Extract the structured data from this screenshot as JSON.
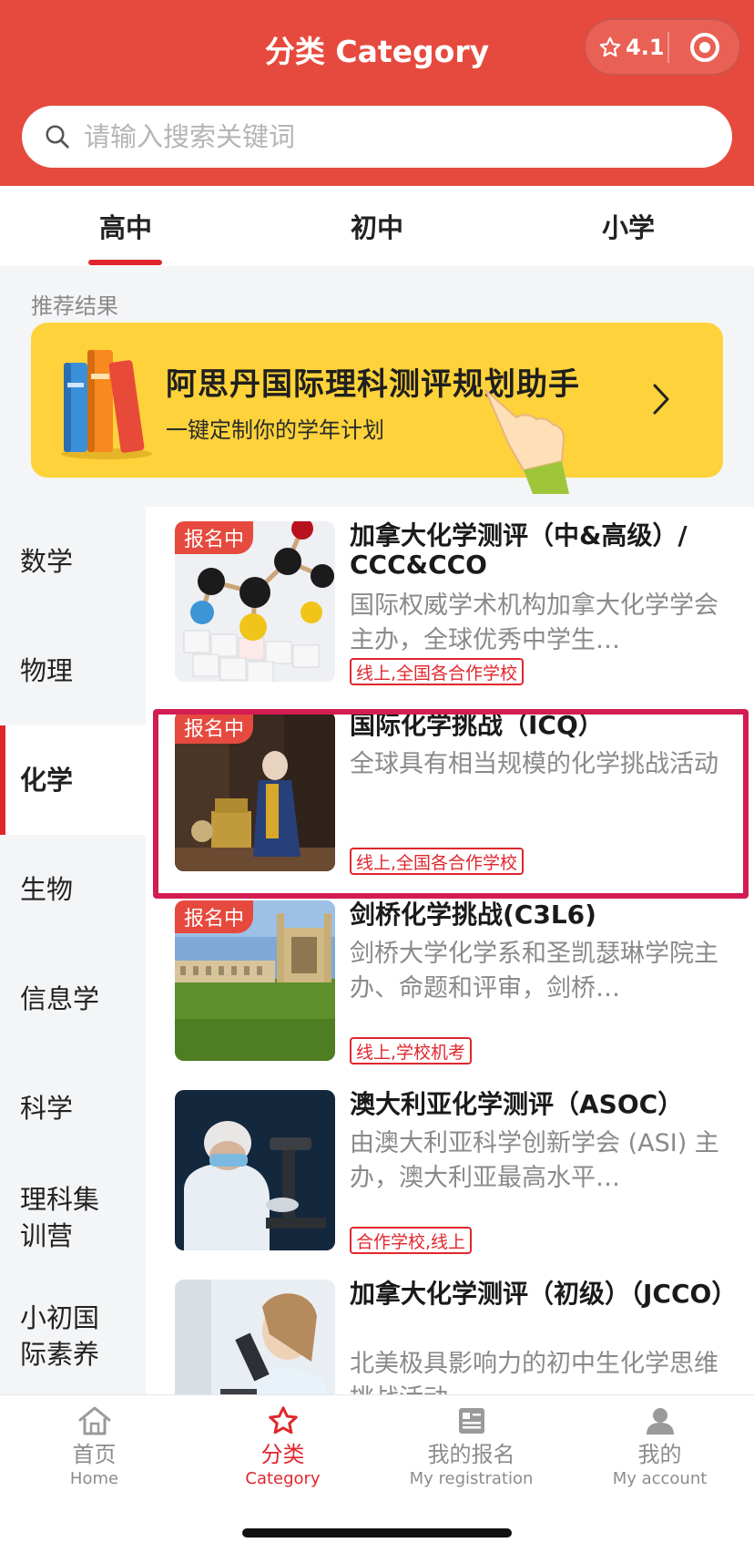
{
  "header": {
    "title": "分类 Category",
    "rating": "4.1",
    "color": "#e64a3e"
  },
  "search": {
    "placeholder": "请输入搜索关键词"
  },
  "tabs": [
    {
      "label": "高中",
      "active": true
    },
    {
      "label": "初中",
      "active": false
    },
    {
      "label": "小学",
      "active": false
    }
  ],
  "recommend": {
    "label": "推荐结果",
    "banner_title": "阿思丹国际理科测评规划助手",
    "banner_subtitle": "一键定制你的学年计划"
  },
  "sidebar": {
    "items": [
      {
        "label": "数学"
      },
      {
        "label": "物理"
      },
      {
        "label": "化学",
        "active": true
      },
      {
        "label": "生物"
      },
      {
        "label": "信息学"
      },
      {
        "label": "科学"
      },
      {
        "label": "理科集训营"
      },
      {
        "label": "小初国际素养"
      }
    ]
  },
  "courses": [
    {
      "badge": "报名中",
      "title": "加拿大化学测评（中&高级）/ CCC&CCO",
      "desc": "国际权威学术机构加拿大化学学会主办，全球优秀中学生…",
      "tag": "线上,全国各合作学校",
      "image": "molecule-model-image"
    },
    {
      "badge": "报名中",
      "title": "国际化学挑战（ICQ）",
      "desc": "全球具有相当规模的化学挑战活动",
      "tag": "线上,全国各合作学校",
      "image": "lavoisier-painting-image",
      "highlighted": true
    },
    {
      "badge": "报名中",
      "title": "剑桥化学挑战(C3L6)",
      "desc": "剑桥大学化学系和圣凯瑟琳学院主办、命题和评审，剑桥…",
      "tag": "线上,学校机考",
      "image": "cambridge-college-image"
    },
    {
      "badge": "",
      "title": "澳大利亚化学测评（ASOC）",
      "desc": "由澳大利亚科学创新学会 (ASI) 主办，澳大利亚最高水平…",
      "tag": "合作学校,线上",
      "image": "lab-microscope-image"
    },
    {
      "badge": "",
      "title": "加拿大化学测评（初级）（JCCO）",
      "desc": "北美极具影响力的初中生化学思维挑战活动",
      "tag": "",
      "image": "scientist-microscope-image"
    }
  ],
  "bottom_nav": [
    {
      "label": "首页",
      "sub": "Home",
      "icon": "home-icon"
    },
    {
      "label": "分类",
      "sub": "Category",
      "icon": "star-icon",
      "active": true
    },
    {
      "label": "我的报名",
      "sub": "My registration",
      "icon": "registration-icon"
    },
    {
      "label": "我的",
      "sub": "My account",
      "icon": "account-icon"
    }
  ]
}
